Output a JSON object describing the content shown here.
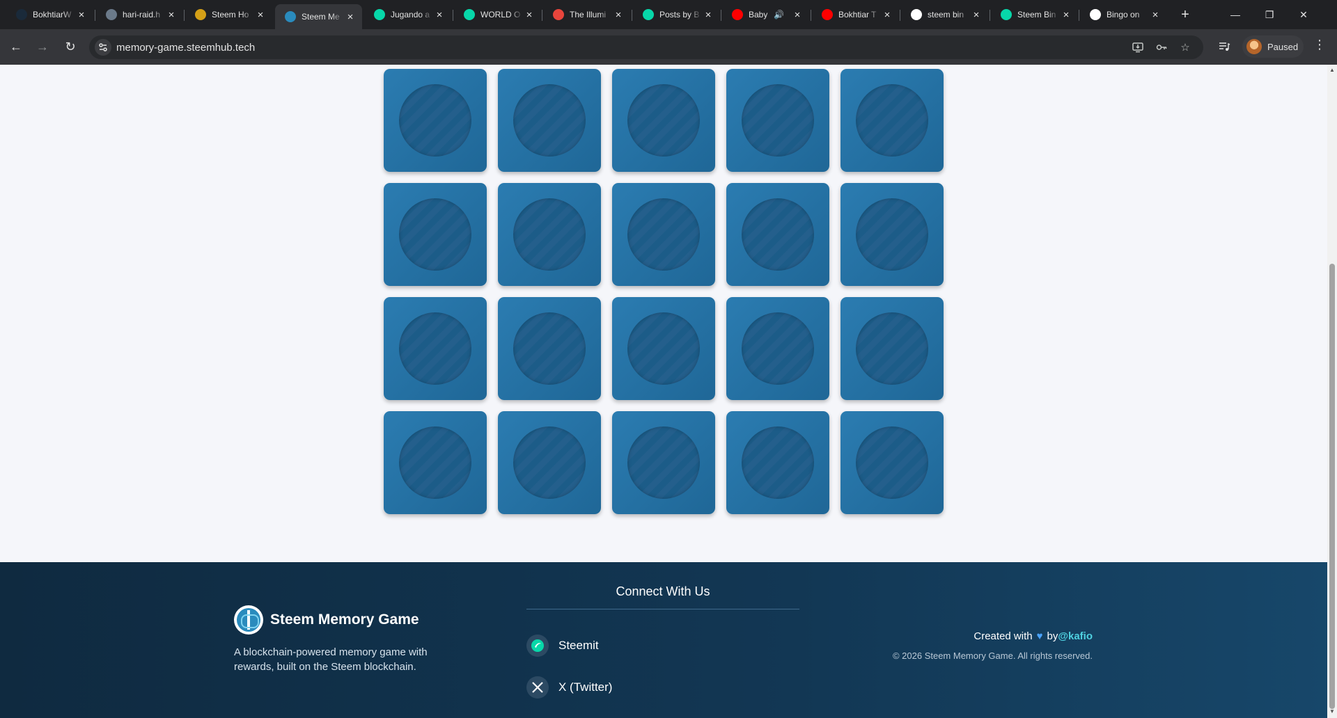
{
  "browser": {
    "tabs": [
      {
        "label": "BokhtiarW",
        "favicon_color": "#1a2a3a",
        "favicon": "steem-icon"
      },
      {
        "label": "hari-raid.h",
        "favicon_color": "#6b7a8a",
        "favicon": "avatar-icon"
      },
      {
        "label": "Steem Ho",
        "favicon_color": "#d4a017",
        "favicon": "steemhub-icon"
      },
      {
        "label": "Steem Me",
        "favicon_color": "#2a8bbd",
        "favicon": "memory-game-icon",
        "active": true
      },
      {
        "label": "Jugando a",
        "favicon_color": "#07d7a9",
        "favicon": "steemit-icon"
      },
      {
        "label": "WORLD O",
        "favicon_color": "#07d7a9",
        "favicon": "steemit-icon"
      },
      {
        "label": "The Illumi",
        "favicon_color": "#e8453c",
        "favicon": "map-pin-icon"
      },
      {
        "label": "Posts by B",
        "favicon_color": "#07d7a9",
        "favicon": "steemit-icon"
      },
      {
        "label": "Baby",
        "favicon_color": "#ff0000",
        "favicon": "youtube-icon",
        "audio": true
      },
      {
        "label": "Bokhtiar T",
        "favicon_color": "#ff0000",
        "favicon": "youtube-icon"
      },
      {
        "label": "steem bin",
        "favicon_color": "#ffffff",
        "favicon": "google-icon"
      },
      {
        "label": "Steem Bin",
        "favicon_color": "#07d7a9",
        "favicon": "steemit-icon"
      },
      {
        "label": "Bingo on",
        "favicon_color": "#ffffff",
        "favicon": "triangle-icon"
      }
    ],
    "url": "memory-game.steemhub.tech",
    "profile_label": "Paused"
  },
  "game": {
    "rows": 4,
    "columns": 5,
    "card_count": 20,
    "card_state": "face-down"
  },
  "footer": {
    "brand_name": "Steem Memory Game",
    "tagline": "A blockchain-powered memory game with rewards, built on the Steem blockchain.",
    "connect_heading": "Connect With Us",
    "socials": [
      {
        "label": "Steemit",
        "icon": "steemit-icon"
      },
      {
        "label": "X (Twitter)",
        "icon": "x-twitter-icon"
      }
    ],
    "created_with": "Created with",
    "by": "by",
    "handle": "@kafio",
    "copyright": "© 2026 Steem Memory Game. All rights reserved."
  },
  "colors": {
    "card": "#2b7cb1",
    "card_disc": "#1c5c88",
    "footer_bg": "#123754",
    "handle_accent": "#4fd0e0",
    "heart": "#4aa3ff"
  }
}
